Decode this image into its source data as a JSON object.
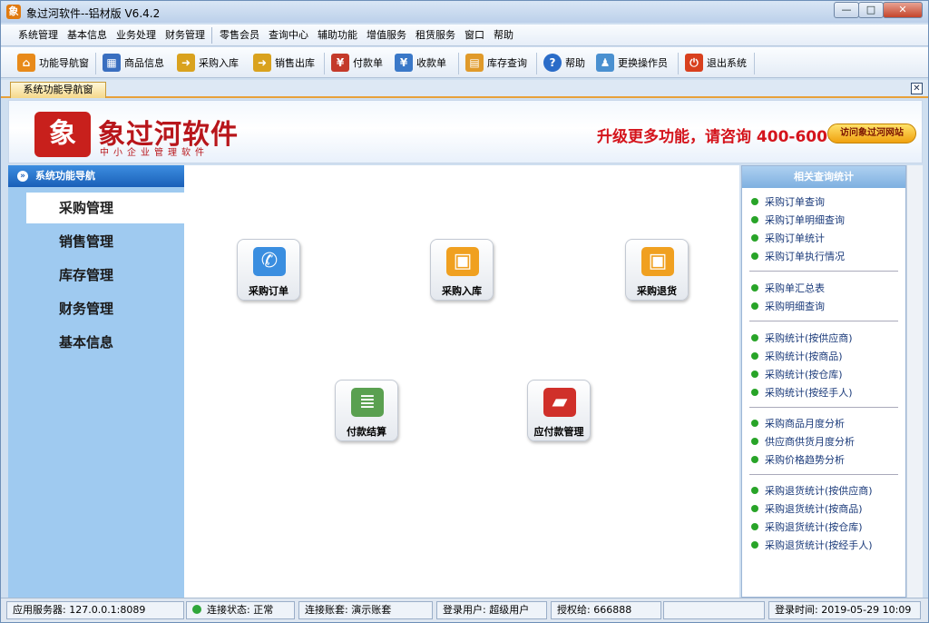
{
  "window": {
    "title": "象过河软件--铝材版 V6.4.2",
    "minimize": "—",
    "maximize": "□",
    "close": "✕",
    "app_icon": "象"
  },
  "menubar": {
    "items": [
      "系统管理",
      "基本信息",
      "业务处理",
      "财务管理",
      "零售会员",
      "查询中心",
      "辅助功能",
      "增值服务",
      "租赁服务",
      "窗口",
      "帮助"
    ]
  },
  "toolbar": {
    "items": [
      {
        "label": "功能导航窗",
        "icon": "home-icon",
        "glyph": "⌂",
        "color": "#e88a1a"
      },
      {
        "label": "商品信息",
        "icon": "grid-icon",
        "glyph": "▦",
        "color": "#3a6fc0"
      },
      {
        "label": "采购入库",
        "icon": "folder-in-icon",
        "glyph": "➜",
        "color": "#d9a21e"
      },
      {
        "label": "销售出库",
        "icon": "folder-out-icon",
        "glyph": "➜",
        "color": "#d9a21e"
      },
      {
        "label": "付款单",
        "icon": "pay-icon",
        "glyph": "¥",
        "color": "#c43a2a"
      },
      {
        "label": "收款单",
        "icon": "receive-icon",
        "glyph": "¥",
        "color": "#3a78c8"
      },
      {
        "label": "库存查询",
        "icon": "inventory-icon",
        "glyph": "▤",
        "color": "#e09a2a"
      },
      {
        "label": "帮助",
        "icon": "help-icon",
        "glyph": "?",
        "color": "#2a6cc8"
      },
      {
        "label": "更换操作员",
        "icon": "users-icon",
        "glyph": "♟",
        "color": "#4a90d0"
      },
      {
        "label": "退出系统",
        "icon": "power-icon",
        "glyph": "⏻",
        "color": "#d8401e"
      }
    ]
  },
  "tab": {
    "label": "系统功能导航窗",
    "close": "✕"
  },
  "banner": {
    "logo_mark": "象",
    "logo_text": "象过河软件",
    "logo_sub": "中小企业管理软件",
    "promo": "升级更多功能，请咨询 400-600-1168",
    "visit_button": "访问象过河网站"
  },
  "sidebar": {
    "header": "系统功能导航",
    "header_icon": "»",
    "items": [
      "采购管理",
      "销售管理",
      "库存管理",
      "财务管理",
      "基本信息"
    ],
    "active": "采购管理"
  },
  "functions": [
    {
      "label": "采购订单",
      "icon": "phone-order-icon",
      "glyph": "✆",
      "color": "#3a8ee0"
    },
    {
      "label": "采购入库",
      "icon": "boxes-in-icon",
      "glyph": "▣",
      "color": "#f0a020"
    },
    {
      "label": "采购退货",
      "icon": "boxes-return-icon",
      "glyph": "▣",
      "color": "#f0a020"
    },
    {
      "label": "付款结算",
      "icon": "coins-sheet-icon",
      "glyph": "≣",
      "color": "#5aa050"
    },
    {
      "label": "应付款管理",
      "icon": "wallet-icon",
      "glyph": "▰",
      "color": "#d0302a"
    }
  ],
  "right_panel": {
    "header": "相关查询统计",
    "groups": [
      [
        "采购订单查询",
        "采购订单明细查询",
        "采购订单统计",
        "采购订单执行情况"
      ],
      [
        "采购单汇总表",
        "采购明细查询"
      ],
      [
        "采购统计(按供应商)",
        "采购统计(按商品)",
        "采购统计(按仓库)",
        "采购统计(按经手人)"
      ],
      [
        "采购商品月度分析",
        "供应商供货月度分析",
        "采购价格趋势分析"
      ],
      [
        "采购退货统计(按供应商)",
        "采购退货统计(按商品)",
        "采购退货统计(按仓库)",
        "采购退货统计(按经手人)"
      ]
    ]
  },
  "status": {
    "server": "应用服务器: 127.0.0.1:8089",
    "connection": "连接状态: 正常",
    "account": "连接账套: 演示账套",
    "user": "登录用户: 超级用户",
    "license": "授权给: 666888",
    "login_time": "登录时间: 2019-05-29 10:09"
  }
}
